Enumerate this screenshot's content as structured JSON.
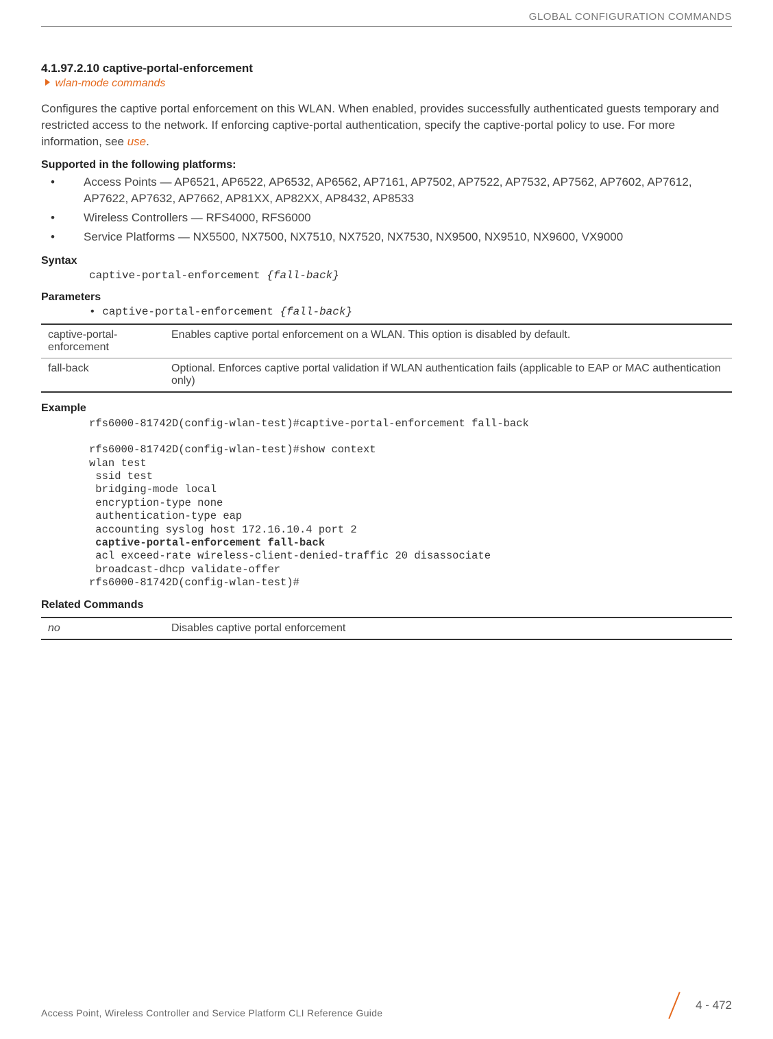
{
  "header": {
    "title": "GLOBAL CONFIGURATION COMMANDS"
  },
  "section": {
    "number_title": "4.1.97.2.10 captive-portal-enforcement",
    "subtitle": "wlan-mode commands"
  },
  "intro": {
    "text_pre": "Configures the captive portal enforcement on this WLAN. When enabled, provides successfully authenticated guests temporary and restricted access to the network. If enforcing captive-portal authentication, specify the captive-portal policy to use. For more information, see ",
    "link": "use",
    "text_post": "."
  },
  "supported": {
    "heading": "Supported in the following platforms:",
    "items": [
      "Access Points — AP6521, AP6522, AP6532, AP6562, AP7161, AP7502, AP7522, AP7532, AP7562, AP7602, AP7612, AP7622, AP7632, AP7662, AP81XX, AP82XX, AP8432, AP8533",
      "Wireless Controllers — RFS4000, RFS6000",
      "Service Platforms — NX5500, NX7500, NX7510, NX7520, NX7530, NX9500, NX9510, NX9600, VX9000"
    ]
  },
  "syntax": {
    "heading": "Syntax",
    "cmd": "captive-portal-enforcement ",
    "arg": "{fall-back}"
  },
  "parameters": {
    "heading": "Parameters",
    "line_prefix": "• ",
    "cmd": "captive-portal-enforcement ",
    "arg": "{fall-back}",
    "rows": [
      {
        "name": "captive-portal-enforcement",
        "desc": "Enables captive portal enforcement on a WLAN. This option is disabled by default."
      },
      {
        "name": "fall-back",
        "desc": "Optional. Enforces captive portal validation if WLAN authentication fails (applicable to EAP or MAC authentication only)"
      }
    ]
  },
  "example": {
    "heading": "Example",
    "line1": "rfs6000-81742D(config-wlan-test)#captive-portal-enforcement fall-back",
    "blank": "",
    "line2": "rfs6000-81742D(config-wlan-test)#show context",
    "line3": "wlan test",
    "line4": " ssid test",
    "line5": " bridging-mode local",
    "line6": " encryption-type none",
    "line7": " authentication-type eap",
    "line8": " accounting syslog host 172.16.10.4 port 2",
    "line9": " captive-portal-enforcement fall-back",
    "line10": " acl exceed-rate wireless-client-denied-traffic 20 disassociate",
    "line11": " broadcast-dhcp validate-offer",
    "line12": "rfs6000-81742D(config-wlan-test)#"
  },
  "related": {
    "heading": "Related Commands",
    "rows": [
      {
        "name": "no",
        "desc": "Disables captive portal enforcement"
      }
    ]
  },
  "footer": {
    "left": "Access Point, Wireless Controller and Service Platform CLI Reference Guide",
    "page": "4 - 472"
  }
}
